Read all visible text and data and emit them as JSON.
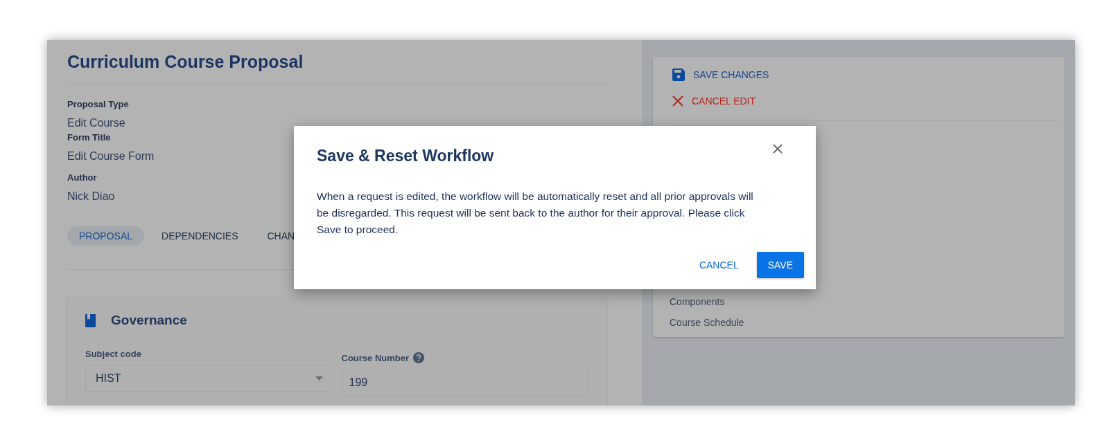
{
  "page": {
    "title": "Curriculum Course Proposal",
    "fields": [
      {
        "label": "Proposal Type",
        "value": "Edit Course"
      },
      {
        "label": "Form Title",
        "value": "Edit Course Form"
      },
      {
        "label": "Author",
        "value": "Nick Diao"
      }
    ],
    "tabs": [
      {
        "label": "PROPOSAL",
        "selected": true
      },
      {
        "label": "DEPENDENCIES",
        "selected": false
      },
      {
        "label": "CHAN",
        "selected": false
      }
    ],
    "section": {
      "title": "Governance",
      "subject_code": {
        "label": "Subject code",
        "value": "HIST"
      },
      "course_number": {
        "label": "Course Number",
        "value": "199"
      }
    }
  },
  "sidebar": {
    "actions": [
      {
        "kind": "save",
        "label": "SAVE CHANGES"
      },
      {
        "kind": "cancel",
        "label": "CANCEL EDIT"
      }
    ],
    "links": [
      "Components",
      "Course Schedule"
    ]
  },
  "dialog": {
    "title": "Save & Reset Workflow",
    "message": "When a request is edited, the workflow will be automatically reset and all prior approvals will be disregarded. This request will be sent back to the author for their approval. Please click Save to proceed.",
    "buttons": [
      {
        "kind": "text",
        "label": "CANCEL"
      },
      {
        "kind": "primary",
        "label": "SAVE"
      }
    ]
  }
}
